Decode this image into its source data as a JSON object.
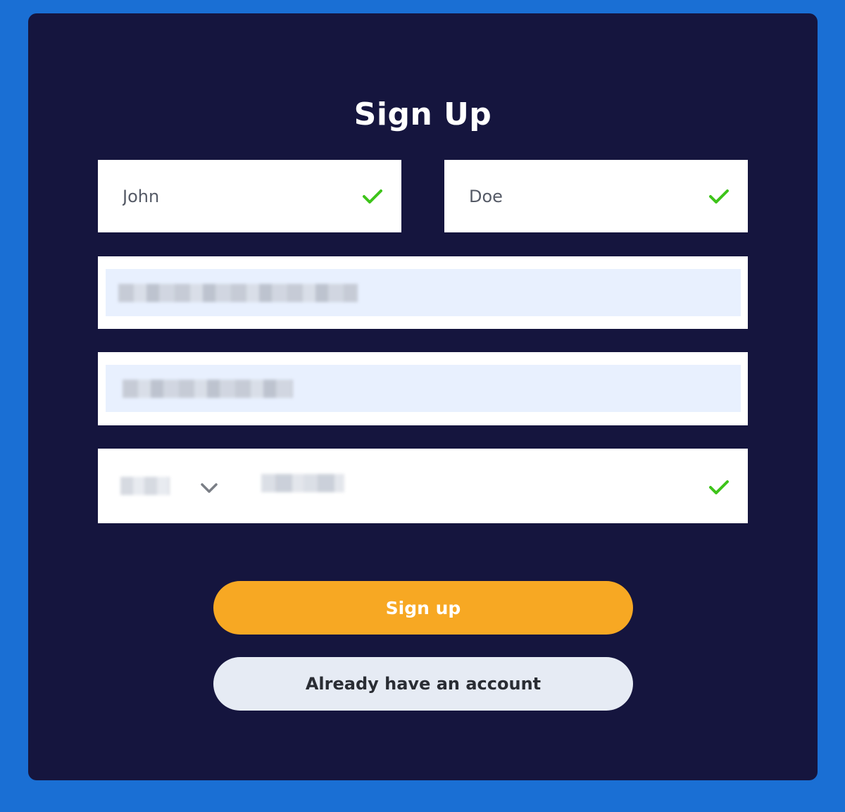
{
  "form": {
    "title": "Sign Up",
    "first_name": {
      "value": "John",
      "valid": true
    },
    "last_name": {
      "value": "Doe",
      "valid": true
    },
    "email": {
      "value": "",
      "autofilled": true,
      "redacted": true
    },
    "password": {
      "value": "",
      "autofilled": true,
      "redacted": true
    },
    "phone": {
      "country_code": "",
      "number": "",
      "redacted": true,
      "valid": true
    }
  },
  "buttons": {
    "signup_label": "Sign up",
    "login_label": "Already have an account"
  },
  "colors": {
    "page_background": "#1a6fd4",
    "card_background": "#15153e",
    "primary_button": "#f7a823",
    "secondary_button": "#e6ebf4",
    "valid_check": "#3ec41a",
    "autofill_background": "#e8f0fe"
  },
  "icons": {
    "valid": "check-icon",
    "dropdown": "chevron-down-icon"
  }
}
